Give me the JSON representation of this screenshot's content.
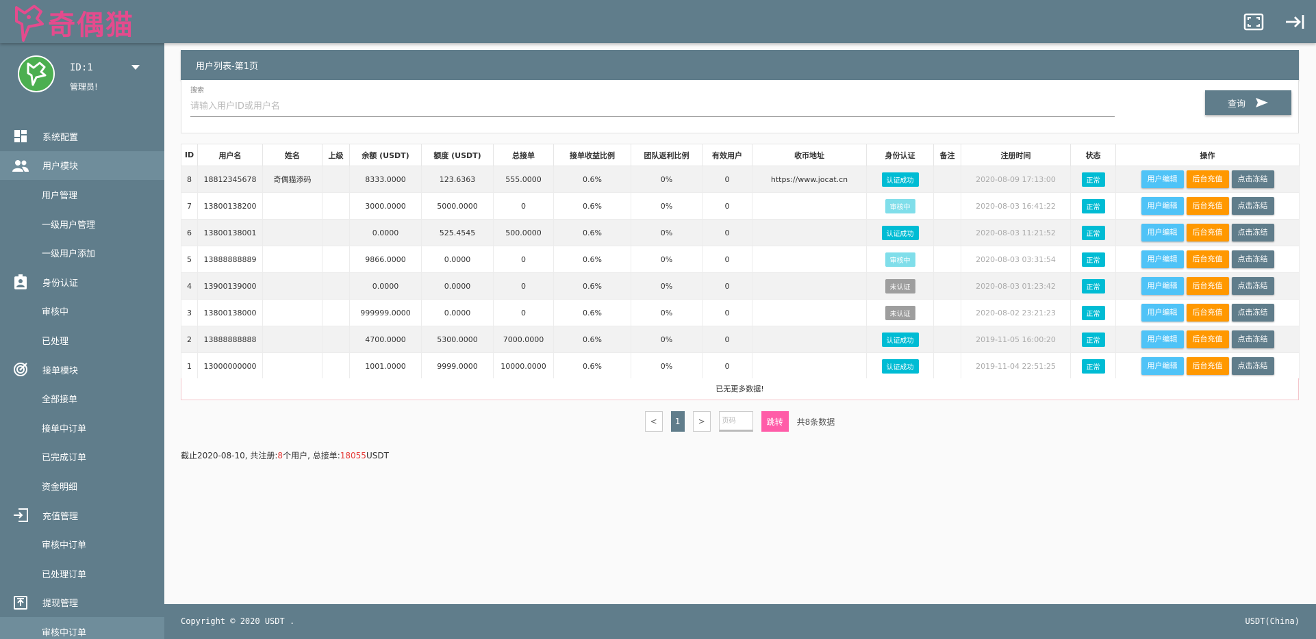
{
  "brand": {
    "logo_text": "奇偶猫",
    "logo_color": "#e44b8d"
  },
  "colors": {
    "primary": "#607d8b",
    "success": "#00bcd4",
    "pending": "#80deea",
    "unverified": "#9e9e9e",
    "edit": "#4fc3f7",
    "recharge": "#ff9800",
    "freeze": "#607d8b",
    "jump": "#ff5ca8",
    "highlight": "#e53935"
  },
  "topbar": {
    "icons": [
      "fullscreen-icon",
      "logout-icon"
    ]
  },
  "profile": {
    "id": "ID:1",
    "role": "管理员!"
  },
  "menu": [
    {
      "type": "group",
      "label": "系统配置",
      "icon": "dashboard-icon"
    },
    {
      "type": "group",
      "label": "用户模块",
      "icon": "users-icon",
      "active": true
    },
    {
      "type": "sub",
      "label": "用户管理"
    },
    {
      "type": "sub",
      "label": "一级用户管理"
    },
    {
      "type": "sub",
      "label": "一级用户添加"
    },
    {
      "type": "group",
      "label": "身份认证",
      "icon": "id-badge-icon"
    },
    {
      "type": "sub",
      "label": "审核中"
    },
    {
      "type": "sub",
      "label": "已处理"
    },
    {
      "type": "group",
      "label": "接单模块",
      "icon": "target-icon"
    },
    {
      "type": "sub",
      "label": "全部接单"
    },
    {
      "type": "sub",
      "label": "接单中订单"
    },
    {
      "type": "sub",
      "label": "已完成订单"
    },
    {
      "type": "sub",
      "label": "资金明细"
    },
    {
      "type": "group",
      "label": "充值管理",
      "icon": "login-icon"
    },
    {
      "type": "sub",
      "label": "审核中订单"
    },
    {
      "type": "sub",
      "label": "已处理订单"
    },
    {
      "type": "group",
      "label": "提现管理",
      "icon": "upload-icon"
    },
    {
      "type": "sub",
      "label": "审核中订单",
      "active": true
    }
  ],
  "page": {
    "title": "用户列表-第1页"
  },
  "search": {
    "label": "搜索",
    "placeholder": "请输入用户ID或用户名",
    "button": "查询"
  },
  "table": {
    "headers": [
      "ID",
      "用户名",
      "姓名",
      "上级",
      "余额 (USDT)",
      "额度 (USDT)",
      "总接单",
      "接单收益比例",
      "团队返利比例",
      "有效用户",
      "收币地址",
      "身份认证",
      "备注",
      "注册时间",
      "状态",
      "操作"
    ],
    "rows": [
      {
        "id": "8",
        "username": "18812345678",
        "name": "奇偶猫添码",
        "parent": "",
        "balance": "8333.0000",
        "quota": "123.6363",
        "orders": "555.0000",
        "order_rate": "0.6%",
        "team_rate": "0%",
        "valid_users": "0",
        "address": "https://www.jocat.cn",
        "auth": "认证成功",
        "auth_state": "success",
        "note": "",
        "reg_time": "2020-08-09 17:13:00",
        "status": "正常"
      },
      {
        "id": "7",
        "username": "13800138200",
        "name": "",
        "parent": "",
        "balance": "3000.0000",
        "quota": "5000.0000",
        "orders": "0",
        "order_rate": "0.6%",
        "team_rate": "0%",
        "valid_users": "0",
        "address": "",
        "auth": "审核中",
        "auth_state": "pending",
        "note": "",
        "reg_time": "2020-08-03 16:41:22",
        "status": "正常"
      },
      {
        "id": "6",
        "username": "13800138001",
        "name": "",
        "parent": "",
        "balance": "0.0000",
        "quota": "525.4545",
        "orders": "500.0000",
        "order_rate": "0.6%",
        "team_rate": "0%",
        "valid_users": "0",
        "address": "",
        "auth": "认证成功",
        "auth_state": "success",
        "note": "",
        "reg_time": "2020-08-03 11:21:52",
        "status": "正常"
      },
      {
        "id": "5",
        "username": "13888888889",
        "name": "",
        "parent": "",
        "balance": "9866.0000",
        "quota": "0.0000",
        "orders": "0",
        "order_rate": "0.6%",
        "team_rate": "0%",
        "valid_users": "0",
        "address": "",
        "auth": "审核中",
        "auth_state": "pending",
        "note": "",
        "reg_time": "2020-08-03 03:31:54",
        "status": "正常"
      },
      {
        "id": "4",
        "username": "13900139000",
        "name": "",
        "parent": "",
        "balance": "0.0000",
        "quota": "0.0000",
        "orders": "0",
        "order_rate": "0.6%",
        "team_rate": "0%",
        "valid_users": "0",
        "address": "",
        "auth": "未认证",
        "auth_state": "none",
        "note": "",
        "reg_time": "2020-08-03 01:23:42",
        "status": "正常"
      },
      {
        "id": "3",
        "username": "13800138000",
        "name": "",
        "parent": "",
        "balance": "999999.0000",
        "quota": "0.0000",
        "orders": "0",
        "order_rate": "0.6%",
        "team_rate": "0%",
        "valid_users": "0",
        "address": "",
        "auth": "未认证",
        "auth_state": "none",
        "note": "",
        "reg_time": "2020-08-02 23:21:23",
        "status": "正常"
      },
      {
        "id": "2",
        "username": "13888888888",
        "name": "",
        "parent": "",
        "balance": "4700.0000",
        "quota": "5300.0000",
        "orders": "7000.0000",
        "order_rate": "0.6%",
        "team_rate": "0%",
        "valid_users": "0",
        "address": "",
        "auth": "认证成功",
        "auth_state": "success",
        "note": "",
        "reg_time": "2019-11-05 16:00:20",
        "status": "正常"
      },
      {
        "id": "1",
        "username": "13000000000",
        "name": "",
        "parent": "",
        "balance": "1001.0000",
        "quota": "9999.0000",
        "orders": "10000.0000",
        "order_rate": "0.6%",
        "team_rate": "0%",
        "valid_users": "0",
        "address": "",
        "auth": "认证成功",
        "auth_state": "success",
        "note": "",
        "reg_time": "2019-11-04 22:51:25",
        "status": "正常"
      }
    ],
    "actions": [
      "用户编辑",
      "后台充值",
      "点击冻结"
    ],
    "no_more": "已无更多数据!"
  },
  "pagination": {
    "prev": "<",
    "current": "1",
    "next": ">",
    "input_placeholder": "页码",
    "jump": "跳转",
    "total": "共8条数据"
  },
  "summary": {
    "prefix": "截止2020-08-10, 共注册:",
    "users": "8",
    "mid": "个用户,  总接单:",
    "orders": "18055",
    "unit": "USDT"
  },
  "footer": {
    "left": "Copyright © 2020 USDT .",
    "right": "USDT(China)"
  }
}
